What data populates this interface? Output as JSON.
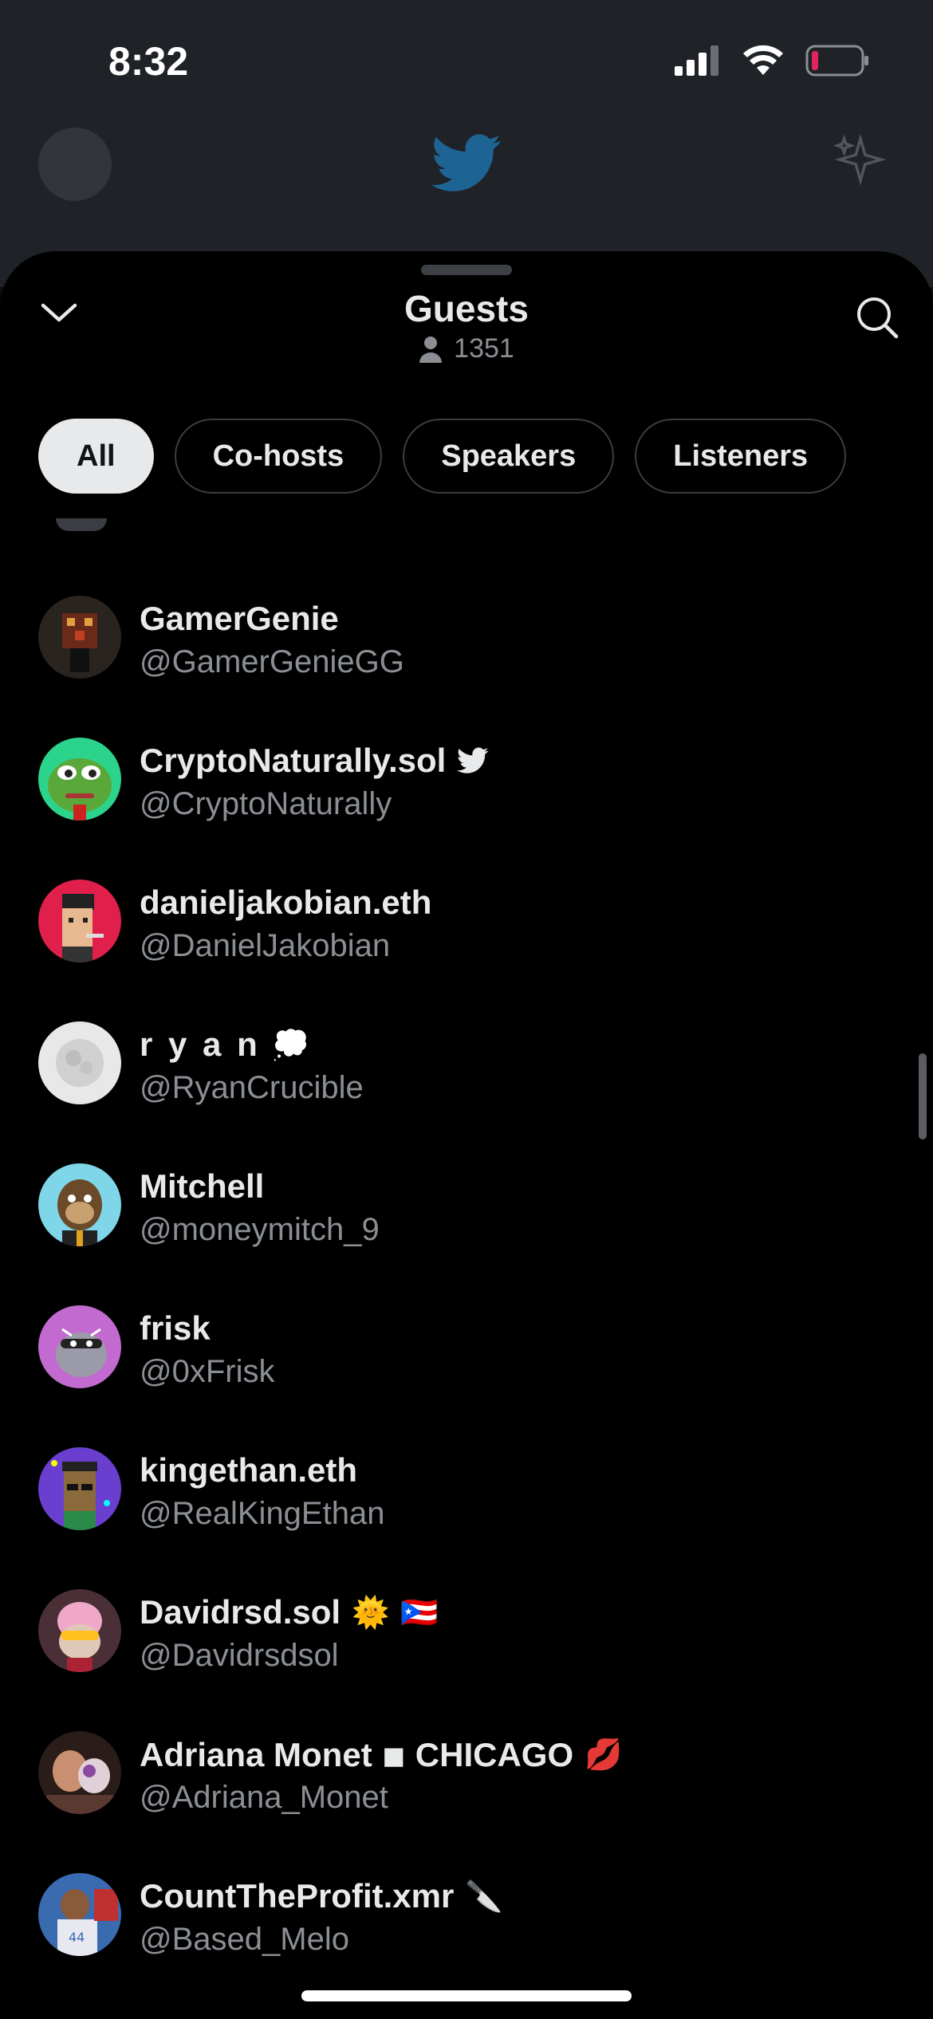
{
  "status_bar": {
    "time": "8:32"
  },
  "sheet": {
    "title": "Guests",
    "listener_count": "1351",
    "filters": [
      {
        "label": "All",
        "active": true
      },
      {
        "label": "Co-hosts",
        "active": false
      },
      {
        "label": "Speakers",
        "active": false
      },
      {
        "label": "Listeners",
        "active": false
      }
    ]
  },
  "guests": [
    {
      "name": "GamerGenie",
      "handle": "@GamerGenieGG",
      "badges": []
    },
    {
      "name": "CryptoNaturally.sol",
      "handle": "@CryptoNaturally",
      "badges": [
        "bird-icon"
      ]
    },
    {
      "name": "danieljakobian.eth",
      "handle": "@DanielJakobian",
      "badges": []
    },
    {
      "name": "r y a n",
      "handle": "@RyanCrucible",
      "badges": [
        "💭"
      ]
    },
    {
      "name": "Mitchell",
      "handle": "@moneymitch_9",
      "badges": []
    },
    {
      "name": "frisk",
      "handle": "@0xFrisk",
      "badges": []
    },
    {
      "name": "kingethan.eth",
      "handle": "@RealKingEthan",
      "badges": []
    },
    {
      "name": "Davidrsd.sol",
      "handle": "@Davidrsdsol",
      "badges": [
        "🌞",
        "🇵🇷"
      ]
    },
    {
      "name": "Adriana Monet  ◾ CHICAGO",
      "handle": "@Adriana_Monet",
      "badges": [
        "💋"
      ]
    },
    {
      "name": "CountTheProfit.xmr",
      "handle": "@Based_Melo",
      "badges": [
        "🔪"
      ]
    }
  ],
  "colors": {
    "accent": "#1d9bf0",
    "text": "#e7e9ea",
    "muted": "#8b8f94"
  }
}
